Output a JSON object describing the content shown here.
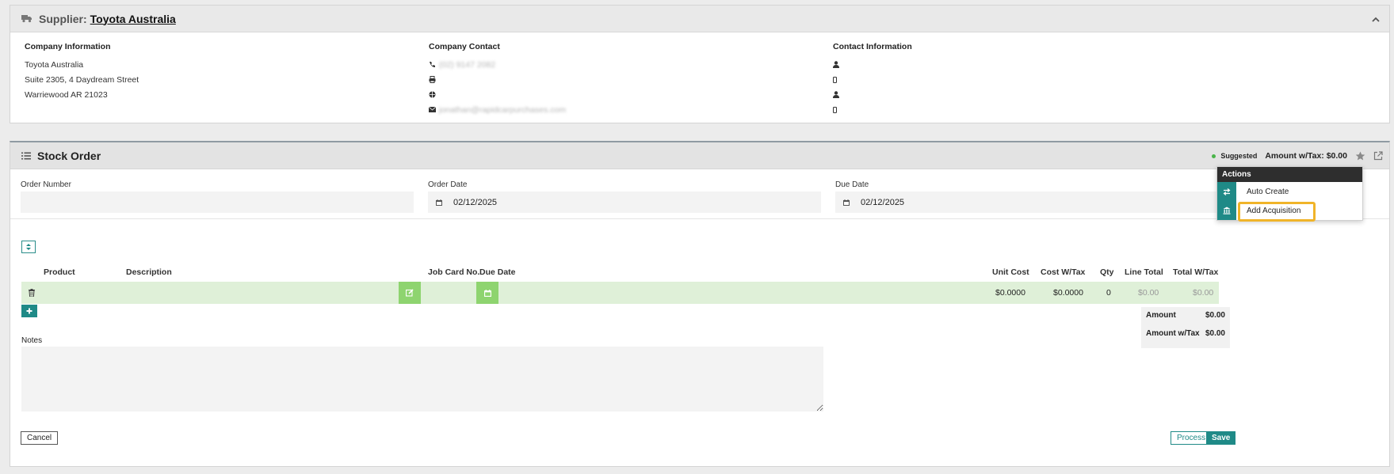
{
  "supplier": {
    "label": "Supplier:",
    "name": "Toyota Australia",
    "company_info": {
      "title": "Company Information",
      "lines": [
        "Toyota Australia",
        "Suite 2305, 4 Daydream Street",
        "Warriewood AR 21023"
      ]
    },
    "company_contact": {
      "title": "Company Contact",
      "phone": "(02) 9147 2082",
      "fax": "",
      "website": "",
      "email": "jonathan@rapidcarpurchases.com"
    },
    "contact_info": {
      "title": "Contact Information"
    }
  },
  "stock_order": {
    "title": "Stock Order",
    "status": "Suggested",
    "amount_tax": "Amount w/Tax: $0.00",
    "fields": {
      "order_number_label": "Order Number",
      "order_number_value": "",
      "order_date_label": "Order Date",
      "order_date_value": "02/12/2025",
      "due_date_label": "Due Date",
      "due_date_value": "02/12/2025"
    },
    "table": {
      "headers": {
        "product": "Product",
        "description": "Description",
        "job_card": "Job Card No.",
        "due_date": "Due Date",
        "unit_cost": "Unit Cost",
        "cost_tax": "Cost W/Tax",
        "qty": "Qty",
        "line_total": "Line Total",
        "total_tax": "Total W/Tax"
      },
      "row": {
        "unit_cost": "$0.0000",
        "cost_tax": "$0.0000",
        "qty": "0",
        "line_total": "$0.00",
        "total_tax": "$0.00"
      }
    },
    "totals": {
      "amount_label": "Amount",
      "amount_value": "$0.00",
      "amount_tax_label": "Amount w/Tax",
      "amount_tax_value": "$0.00"
    },
    "notes_label": "Notes",
    "buttons": {
      "cancel": "Cancel",
      "process": "Process",
      "save": "Save"
    },
    "actions": {
      "title": "Actions",
      "items": [
        "Auto Create",
        "Add Acquisition"
      ]
    }
  },
  "colors": {
    "teal": "#1f8a87",
    "row_green": "#dff0d8",
    "button_green": "#8ed46f",
    "highlight": "#f0b429"
  }
}
